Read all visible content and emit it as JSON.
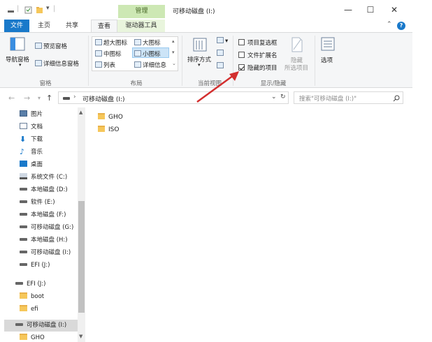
{
  "window": {
    "title": "可移动磁盘 (I:)",
    "context_tab": "管理",
    "controls": {
      "minimize": "—",
      "maximize": "☐",
      "close": "✕"
    }
  },
  "ribbon_tabs": [
    "文件",
    "主页",
    "共享",
    "查看",
    "驱动器工具"
  ],
  "ribbon": {
    "panes": {
      "label": "窗格",
      "nav_pane": "导航窗格",
      "preview_pane": "预览窗格",
      "details_pane": "详细信息窗格"
    },
    "layout": {
      "label": "布局",
      "extra_large": "超大图标",
      "large": "大图标",
      "medium": "中图标",
      "small": "小图标",
      "list": "列表",
      "details": "详细信息"
    },
    "current_view": {
      "label": "当前视图",
      "sort_by": "排序方式"
    },
    "show_hide": {
      "label": "显示/隐藏",
      "item_checkboxes": "项目复选框",
      "file_extensions": "文件扩展名",
      "hidden_items": "隐藏的项目",
      "hide_selected_1": "隐藏",
      "hide_selected_2": "所选项目",
      "item_checkboxes_checked": false,
      "file_extensions_checked": false,
      "hidden_items_checked": true
    },
    "options": "选项"
  },
  "address": {
    "path": "可移动磁盘 (I:)",
    "search_placeholder": "搜索\"可移动磁盘 (I:)\""
  },
  "nav_items": [
    {
      "label": "图片",
      "type": "pictures"
    },
    {
      "label": "文档",
      "type": "documents"
    },
    {
      "label": "下载",
      "type": "downloads"
    },
    {
      "label": "音乐",
      "type": "music"
    },
    {
      "label": "桌面",
      "type": "desktop"
    },
    {
      "label": "系统文件 (C:)",
      "type": "drive"
    },
    {
      "label": "本地磁盘 (D:)",
      "type": "drive"
    },
    {
      "label": "软件 (E:)",
      "type": "drive"
    },
    {
      "label": "本地磁盘 (F:)",
      "type": "drive"
    },
    {
      "label": "可移动磁盘 (G:)",
      "type": "drive"
    },
    {
      "label": "本地磁盘 (H:)",
      "type": "drive"
    },
    {
      "label": "可移动磁盘 (I:)",
      "type": "drive"
    },
    {
      "label": "EFI (J:)",
      "type": "drive"
    }
  ],
  "nav_efi_section": {
    "root": "EFI (J:)",
    "children": [
      "boot",
      "efi"
    ]
  },
  "nav_removable_section": {
    "root": "可移动磁盘 (I:)",
    "children": [
      "GHO"
    ]
  },
  "files": [
    "GHO",
    "ISO"
  ],
  "colors": {
    "accent": "#1979ca",
    "manage_tab": "#cde8b4",
    "selection": "#cce4f7",
    "annotation_arrow": "#d32f2f"
  }
}
